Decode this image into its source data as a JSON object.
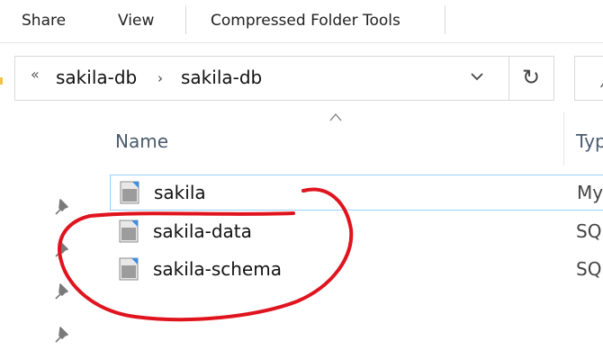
{
  "ribbon": {
    "tabs": [
      {
        "label": "Share"
      },
      {
        "label": "View"
      },
      {
        "label": "Compressed Folder Tools"
      }
    ]
  },
  "addressbar": {
    "overflow_glyph": "«",
    "breadcrumbs": [
      {
        "label": "sakila-db"
      },
      {
        "label": "sakila-db"
      }
    ],
    "separator_glyph": "›",
    "dropdown_icon": "chevron-down-icon",
    "refresh_icon": "refresh-icon",
    "refresh_glyph": "↻",
    "search_glyph": "ﾉ"
  },
  "columns": {
    "name": "Name",
    "type": "Typ"
  },
  "files": [
    {
      "name": "sakila",
      "type": "My",
      "selected": true
    },
    {
      "name": "sakila-data",
      "type": "SQ",
      "selected": false
    },
    {
      "name": "sakila-schema",
      "type": "SQ",
      "selected": false
    }
  ],
  "quick_access_pins": 4,
  "colors": {
    "selection_border": "#99d1ff",
    "annotation": "#e0141e",
    "column_header": "#4a5b6d"
  }
}
